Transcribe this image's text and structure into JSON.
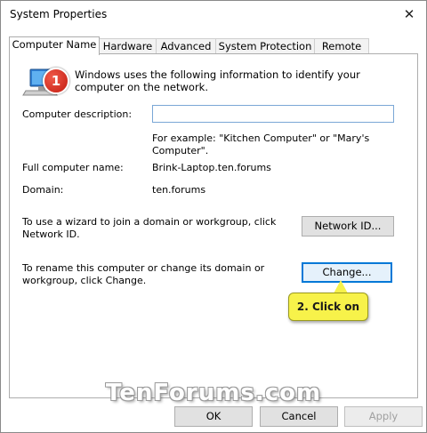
{
  "window": {
    "title": "System Properties",
    "close_glyph": "✕"
  },
  "tabs": [
    {
      "label": "Computer Name",
      "active": true
    },
    {
      "label": "Hardware",
      "active": false
    },
    {
      "label": "Advanced",
      "active": false
    },
    {
      "label": "System Protection",
      "active": false
    },
    {
      "label": "Remote",
      "active": false
    }
  ],
  "panel": {
    "intro": "Windows uses the following information to identify your computer on the network.",
    "description_label": "Computer description:",
    "description_value": "",
    "example_text": "For example: \"Kitchen Computer\" or \"Mary's Computer\".",
    "full_name_label": "Full computer name:",
    "full_name_value": "Brink-Laptop.ten.forums",
    "domain_label": "Domain:",
    "domain_value": "ten.forums",
    "network_id_text": "To use a wizard to join a domain or workgroup, click Network ID.",
    "network_id_button": "Network ID...",
    "rename_text": "To rename this computer or change its domain or workgroup, click Change.",
    "change_button": "Change..."
  },
  "annotations": {
    "badge_number": "1",
    "callout_text": "2. Click on",
    "callout_color": "#f7f24a",
    "badge_color": "#d62a1e"
  },
  "watermark": "TenForums.com",
  "footer": {
    "ok_label": "OK",
    "cancel_label": "Cancel",
    "apply_label": "Apply"
  },
  "icons": {
    "computer": "computer-icon",
    "close": "close-icon"
  }
}
